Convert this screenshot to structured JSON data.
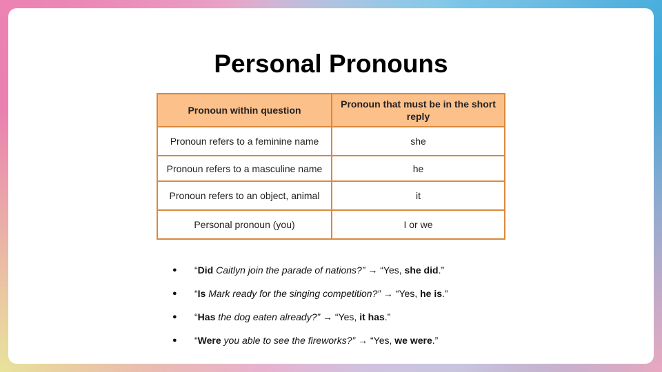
{
  "title": "Personal Pronouns",
  "table": {
    "headers": [
      "Pronoun within question",
      "Pronoun that must be in the short reply"
    ],
    "rows": [
      [
        "Pronoun refers to a feminine name",
        "she"
      ],
      [
        "Pronoun refers to a masculine name",
        "he"
      ],
      [
        "Pronoun refers to an object, animal",
        "it"
      ],
      [
        "Personal pronoun (you)",
        "I or we"
      ]
    ]
  },
  "examples": [
    {
      "open": "“",
      "q_bold": "Did",
      "q_rest": " Caitlyn join the parade of nations?”",
      "arrow": " → ",
      "a_pre": "“Yes, ",
      "a_bold": "she did",
      "a_post": ".”"
    },
    {
      "open": "“",
      "q_bold": "Is",
      "q_rest": " Mark ready for the singing competition?”",
      "arrow": " → ",
      "a_pre": "“Yes, ",
      "a_bold": "he is",
      "a_post": ".”"
    },
    {
      "open": "“",
      "q_bold": "Has",
      "q_rest": " the dog eaten already?”",
      "arrow": " → ",
      "a_pre": "“Yes, ",
      "a_bold": "it has",
      "a_post": ".”"
    },
    {
      "open": "“",
      "q_bold": "Were",
      "q_rest": " you able to see the fireworks?”",
      "arrow": " → ",
      "a_pre": "“Yes, ",
      "a_bold": "we were",
      "a_post": ".”"
    }
  ],
  "bullet_char": "●",
  "colors": {
    "header_fill": "#fcc08a",
    "table_border": "#d9893c"
  }
}
